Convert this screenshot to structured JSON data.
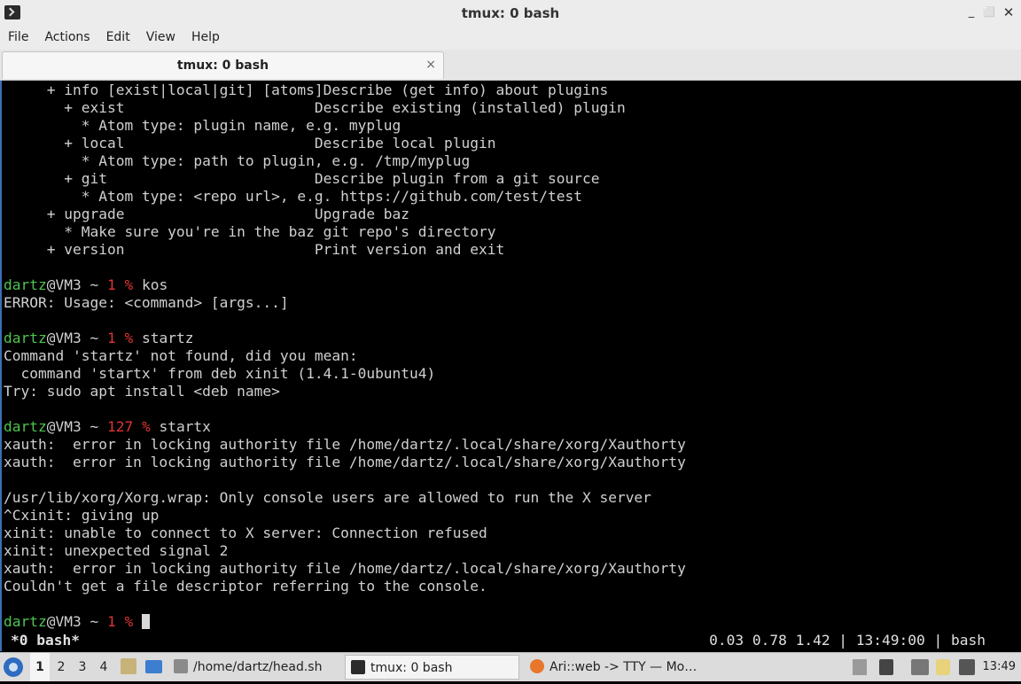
{
  "window": {
    "title": "tmux: 0 bash"
  },
  "menu": [
    "File",
    "Actions",
    "Edit",
    "View",
    "Help"
  ],
  "tab": {
    "label": "tmux: 0 bash",
    "close": "×"
  },
  "terminal_lines": [
    [
      {
        "t": "     + info [exist|local|git] [atoms]Describe (get info) about plugins"
      }
    ],
    [
      {
        "t": "       + exist                      Describe existing (installed) plugin"
      }
    ],
    [
      {
        "t": "         * Atom type: plugin name, e.g. myplug"
      }
    ],
    [
      {
        "t": "       + local                      Describe local plugin"
      }
    ],
    [
      {
        "t": "         * Atom type: path to plugin, e.g. /tmp/myplug"
      }
    ],
    [
      {
        "t": "       + git                        Describe plugin from a git source"
      }
    ],
    [
      {
        "t": "         * Atom type: <repo url>, e.g. https://github.com/test/test"
      }
    ],
    [
      {
        "t": "     + upgrade                      Upgrade baz"
      }
    ],
    [
      {
        "t": "       * Make sure you're in the baz git repo's directory"
      }
    ],
    [
      {
        "t": "     + version                      Print version and exit"
      }
    ],
    [],
    [
      {
        "t": "dartz",
        "c": "g"
      },
      {
        "t": "@VM3 ~ "
      },
      {
        "t": "1 %",
        "c": "r"
      },
      {
        "t": " kos"
      }
    ],
    [
      {
        "t": "ERROR: Usage: <command> [args...]"
      }
    ],
    [],
    [
      {
        "t": "dartz",
        "c": "g"
      },
      {
        "t": "@VM3 ~ "
      },
      {
        "t": "1 %",
        "c": "r"
      },
      {
        "t": " startz"
      }
    ],
    [
      {
        "t": "Command 'startz' not found, did you mean:"
      }
    ],
    [
      {
        "t": "  command 'startx' from deb xinit (1.4.1-0ubuntu4)"
      }
    ],
    [
      {
        "t": "Try: sudo apt install <deb name>"
      }
    ],
    [],
    [
      {
        "t": "dartz",
        "c": "g"
      },
      {
        "t": "@VM3 ~ "
      },
      {
        "t": "127 %",
        "c": "r"
      },
      {
        "t": " startx"
      }
    ],
    [
      {
        "t": "xauth:  error in locking authority file /home/dartz/.local/share/xorg/Xauthorty"
      }
    ],
    [
      {
        "t": "xauth:  error in locking authority file /home/dartz/.local/share/xorg/Xauthorty"
      }
    ],
    [],
    [
      {
        "t": "/usr/lib/xorg/Xorg.wrap: Only console users are allowed to run the X server"
      }
    ],
    [
      {
        "t": "^Cxinit: giving up"
      }
    ],
    [
      {
        "t": "xinit: unable to connect to X server: Connection refused"
      }
    ],
    [
      {
        "t": "xinit: unexpected signal 2"
      }
    ],
    [
      {
        "t": "xauth:  error in locking authority file /home/dartz/.local/share/xorg/Xauthorty"
      }
    ],
    [
      {
        "t": "Couldn't get a file descriptor referring to the console."
      }
    ],
    [],
    [
      {
        "t": "dartz",
        "c": "g"
      },
      {
        "t": "@VM3 ~ "
      },
      {
        "t": "1 %",
        "c": "r"
      },
      {
        "t": " "
      },
      {
        "cursor": true
      }
    ]
  ],
  "status": {
    "left": "*0 bash*",
    "right": "0.03 0.78 1.42 | 13:49:00 | bash"
  },
  "taskbar": {
    "workspaces": [
      "1",
      "2",
      "3",
      "4"
    ],
    "active_workspace": "1",
    "tasks": [
      {
        "label": "/home/dartz/head.sh",
        "icon": "text-editor-icon"
      },
      {
        "label": "tmux: 0 bash",
        "icon": "terminal-icon"
      },
      {
        "label": "Ari::web -> TTY — Mo…",
        "icon": "firefox-icon"
      }
    ],
    "clock": "13:49"
  },
  "colors": {
    "prompt_user": "#4ec44e",
    "prompt_status": "#e03434",
    "terminal_bg": "#000000",
    "accent": "#3a6fb6"
  }
}
